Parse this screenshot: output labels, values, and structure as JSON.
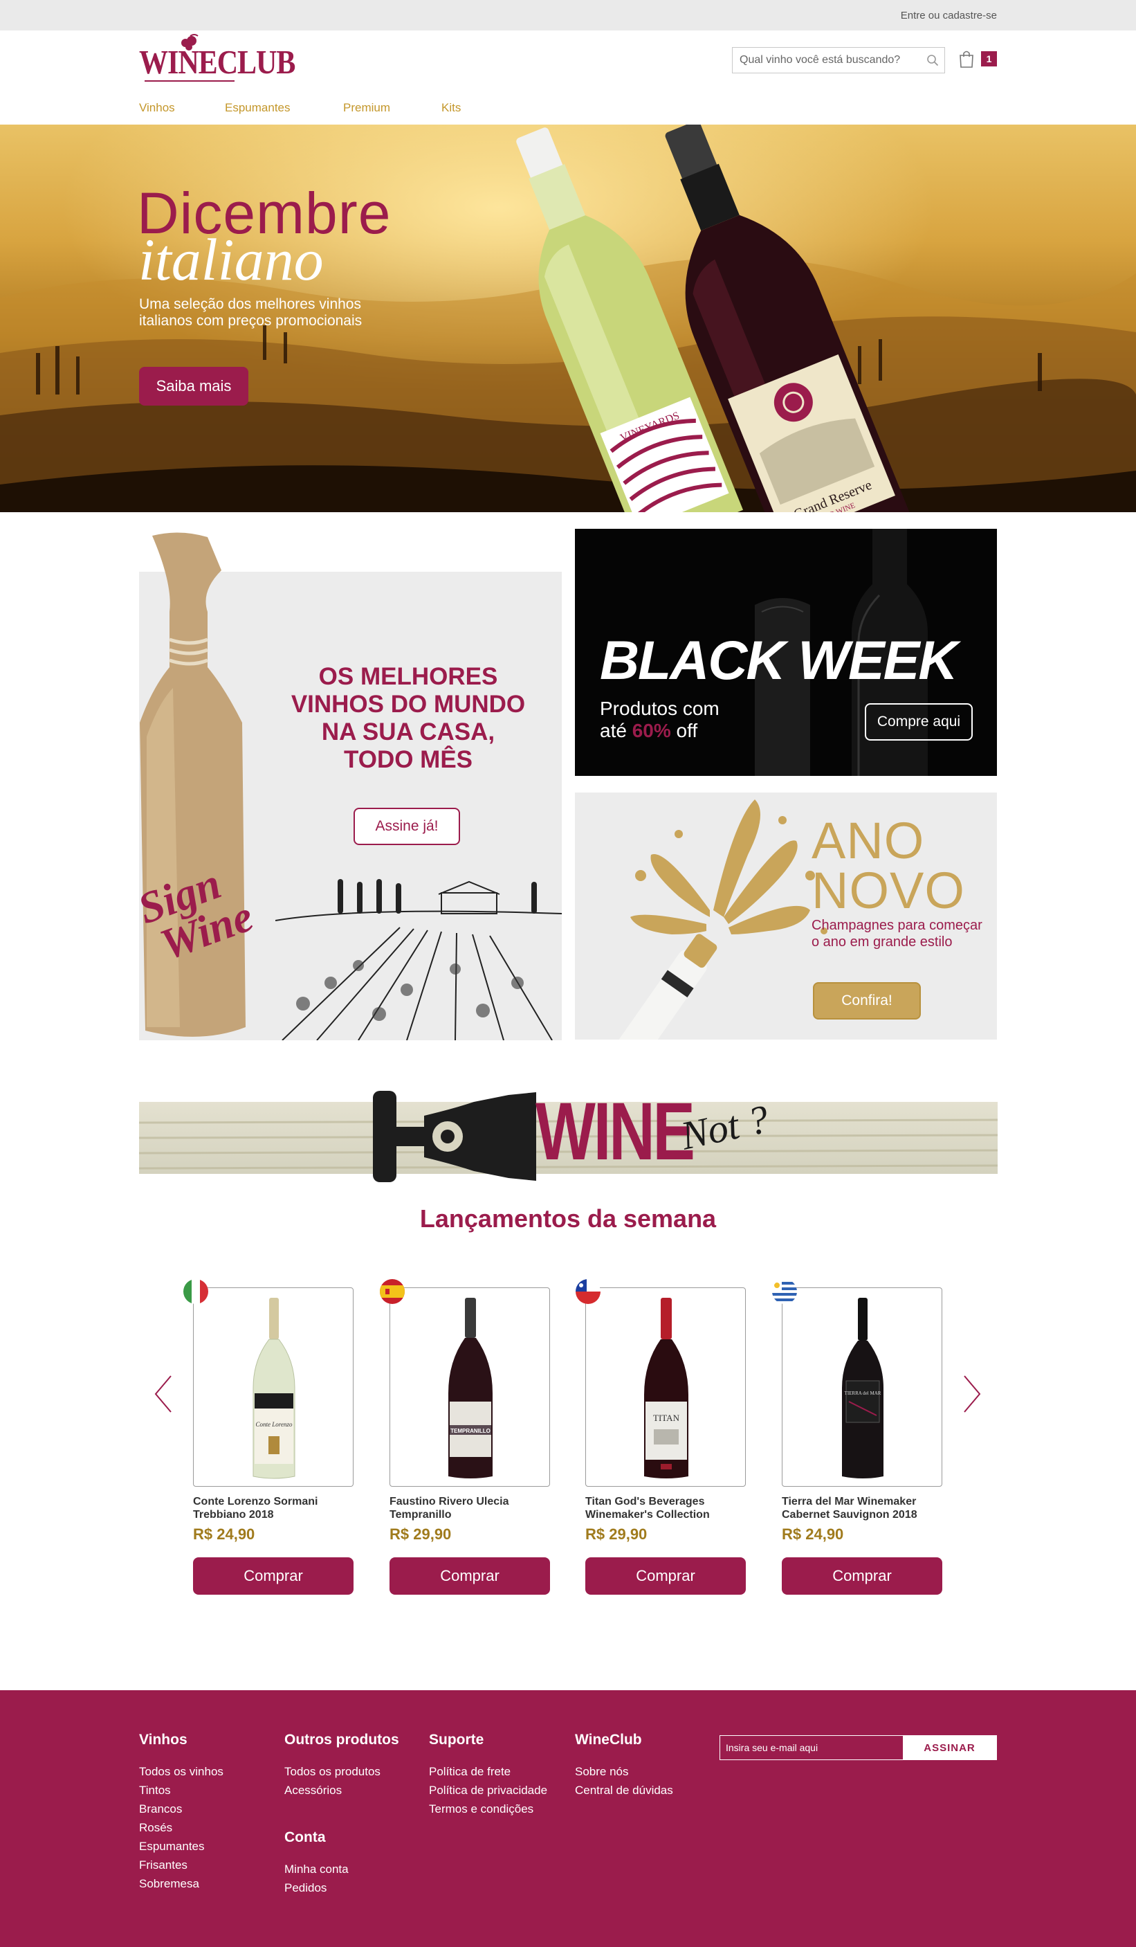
{
  "topbar": {
    "login_link": "Entre ou cadastre-se"
  },
  "header": {
    "logo_text": "WINECLUB",
    "search_placeholder": "Qual vinho você está buscando?",
    "cart_count": "1"
  },
  "nav": {
    "items": [
      "Vinhos",
      "Espumantes",
      "Premium",
      "Kits"
    ]
  },
  "hero": {
    "title_line1": "Dicembre",
    "title_line2": "italiano",
    "subtitle": "Uma seleção dos melhores vinhos italianos com preços promocionais",
    "cta": "Saiba mais",
    "bottle_labels": {
      "white": "VINEYARDS",
      "red": "Grand Reserve",
      "red_sub": "RED WINE"
    }
  },
  "promo_sign": {
    "bottle_brand_line1": "Sign",
    "bottle_brand_line2": "Wine",
    "title_lines": [
      "OS MELHORES",
      "VINHOS DO MUNDO",
      "NA SUA CASA,",
      "TODO MÊS"
    ],
    "cta": "Assine já!"
  },
  "promo_black": {
    "title": "BLACK WEEK",
    "sub_line1": "Produtos com",
    "sub_line2_pre": "até ",
    "sub_line2_hl": "60%",
    "sub_line2_post": " off",
    "cta": "Compre aqui"
  },
  "promo_ano": {
    "title_line1": "ANO",
    "title_line2": "NOVO",
    "subtitle": "Champagnes para começar o ano em grande estilo",
    "cta": "Confira!"
  },
  "winenot": {
    "word": "WINE",
    "suffix": "Not ?"
  },
  "products_section": {
    "title": "Lançamentos da semana",
    "buy_label": "Comprar",
    "products": [
      {
        "name": "Conte Lorenzo Sormani Trebbiano 2018",
        "price": "R$ 24,90",
        "flag": "italy-flag-icon",
        "bottle": "white",
        "label_text": "Conte Lorenzo"
      },
      {
        "name": "Faustino Rivero Ulecia Tempranillo",
        "price": "R$ 29,90",
        "flag": "spain-flag-icon",
        "bottle": "red",
        "label_text": "TEMPRANILLO"
      },
      {
        "name": "Titan God's Beverages Winemaker's Collection",
        "price": "R$ 29,90",
        "flag": "chile-flag-icon",
        "bottle": "red-cap",
        "label_text": "TITAN"
      },
      {
        "name": "Tierra del Mar Winemaker Cabernet Sauvignon 2018",
        "price": "R$ 24,90",
        "flag": "uruguay-flag-icon",
        "bottle": "dark",
        "label_text": "TIERRA del MAR"
      }
    ]
  },
  "footer": {
    "columns": [
      {
        "title": "Vinhos",
        "links": [
          "Todos os vinhos",
          "Tintos",
          "Brancos",
          "Rosés",
          "Espumantes",
          "Frisantes",
          "Sobremesa"
        ]
      },
      {
        "title": "Outros produtos",
        "links": [
          "Todos os produtos",
          "Acessórios"
        ]
      },
      {
        "title": "Conta",
        "links": [
          "Minha conta",
          "Pedidos"
        ]
      },
      {
        "title": "Suporte",
        "links": [
          "Política de frete",
          "Política de privacidade",
          "Termos e condições"
        ]
      },
      {
        "title": "WineClub",
        "links": [
          "Sobre nós",
          "Central de dúvidas"
        ]
      }
    ],
    "newsletter_placeholder": "Insira seu e-mail aqui",
    "newsletter_button": "ASSINAR"
  },
  "colors": {
    "brand": "#9b1c4c",
    "gold": "#c9a55a",
    "price": "#a07b1d",
    "nav": "#c4972b"
  }
}
